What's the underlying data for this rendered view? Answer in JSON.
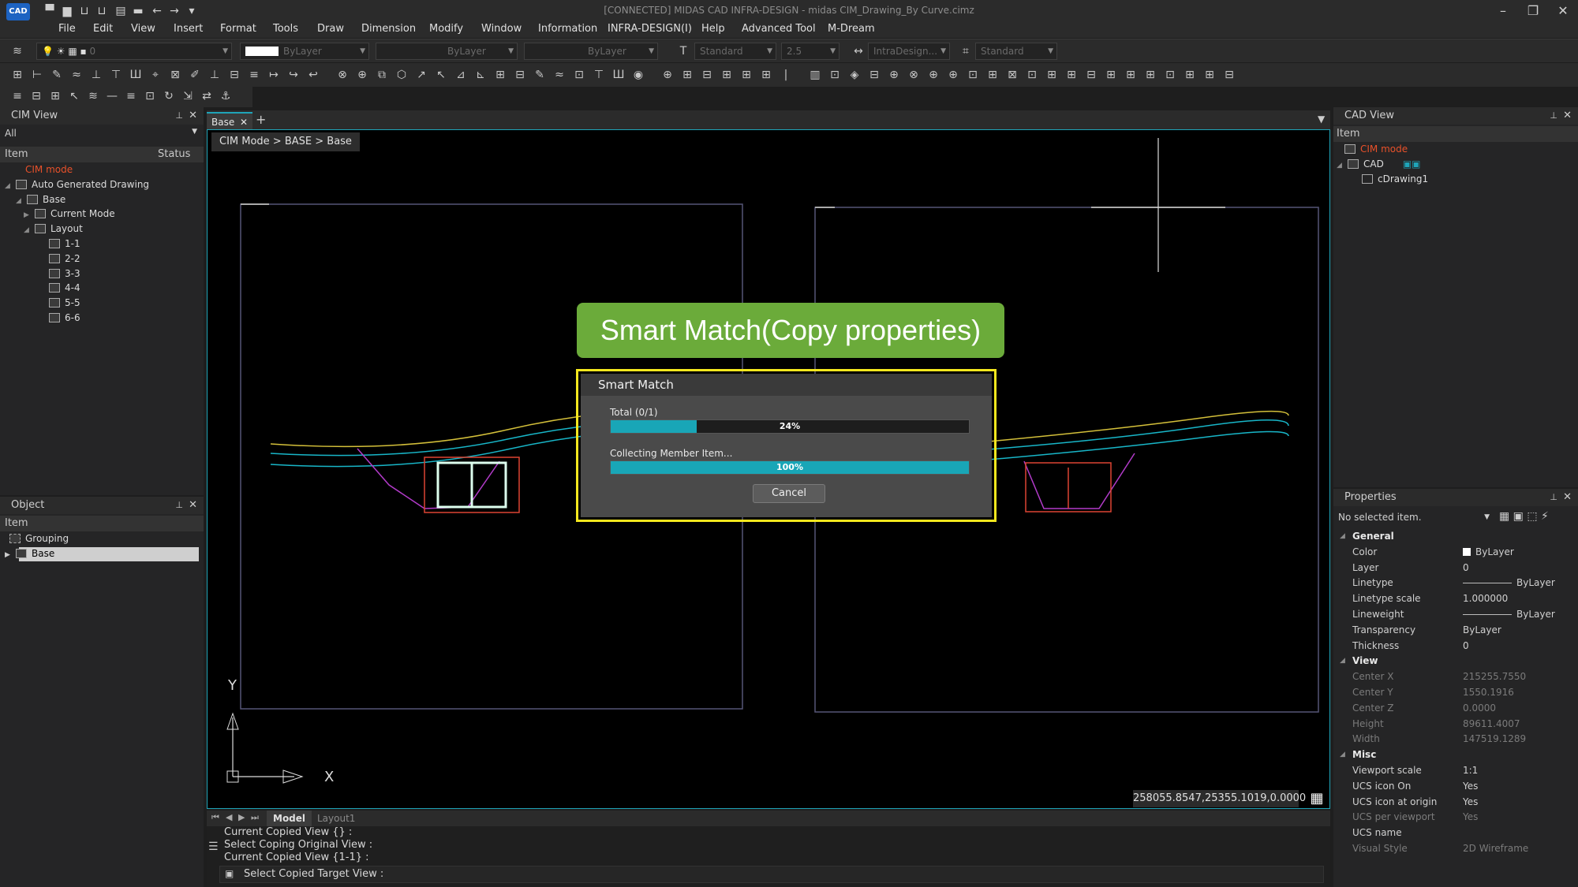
{
  "titlebar": {
    "logo": "CAD",
    "title": "[CONNECTED] MIDAS CAD INFRA-DESIGN - midas CIM_Drawing_By Curve.cimz",
    "quick_icons": [
      "new-icon",
      "open-icon",
      "import-icon",
      "export-icon",
      "print-icon",
      "save-icon",
      "stop-icon",
      "undo-icon",
      "redo-icon",
      "dropdown-icon"
    ]
  },
  "menu": [
    "File",
    "Edit",
    "View",
    "Insert",
    "Format",
    "Tools",
    "Draw",
    "Dimension",
    "Modify",
    "Window",
    "Information",
    "INFRA-DESIGN(I)",
    "Help",
    "Advanced Tool",
    "M-Dream"
  ],
  "toolbar1": {
    "layer": "0",
    "color": "ByLayer",
    "linetype": "ByLayer",
    "lineweight": "ByLayer",
    "text_style": "Standard",
    "text_height": "2.5",
    "dim_style": "IntraDesign...",
    "table_style": "Standard"
  },
  "cim_view": {
    "title": "CIM View",
    "filter": "All",
    "columns": [
      "Item",
      "Status"
    ],
    "tree": [
      {
        "label": "CIM mode",
        "level": 1,
        "accent": true
      },
      {
        "label": "Auto Generated Drawing",
        "level": 0
      },
      {
        "label": "Base",
        "level": 1
      },
      {
        "label": "Current Mode",
        "level": 2
      },
      {
        "label": "Layout",
        "level": 2
      },
      {
        "label": "1-1",
        "level": 3
      },
      {
        "label": "2-2",
        "level": 3
      },
      {
        "label": "3-3",
        "level": 3
      },
      {
        "label": "4-4",
        "level": 3
      },
      {
        "label": "5-5",
        "level": 3
      },
      {
        "label": "6-6",
        "level": 3
      }
    ]
  },
  "object_panel": {
    "title": "Object",
    "column": "Item",
    "items": [
      "Grouping",
      "Base"
    ]
  },
  "tabs": {
    "active": "Base"
  },
  "breadcrumb": "CIM Mode > BASE > Base",
  "banner": "Smart Match(Copy properties)",
  "dialog": {
    "title": "Smart Match",
    "total_label": "Total (0/1)",
    "total_progress": 0.24,
    "total_text": "24%",
    "member_label": "Collecting Member Item...",
    "member_progress": 1.0,
    "member_text": "100%",
    "cancel": "Cancel"
  },
  "coordinates": "258055.8547,25355.1019,0.0000",
  "axes": {
    "y": "Y",
    "x": "X"
  },
  "layout_tabs": [
    "Model",
    "Layout1"
  ],
  "command_lines": [
    "Current Copied View {} :",
    "Select Coping Original View :",
    "Current Copied View {1-1} :"
  ],
  "command_prompt": "Select Copied Target View :",
  "cad_view": {
    "title": "CAD View",
    "column": "Item",
    "tree": [
      {
        "label": "CIM mode",
        "accent": true
      },
      {
        "label": "CAD"
      },
      {
        "label": "cDrawing1"
      }
    ]
  },
  "properties": {
    "title": "Properties",
    "selection": "No selected item.",
    "sections": [
      {
        "name": "General",
        "rows": [
          {
            "k": "Color",
            "v": "ByLayer",
            "swatch": true
          },
          {
            "k": "Layer",
            "v": "0"
          },
          {
            "k": "Linetype",
            "v": "ByLayer",
            "line": true
          },
          {
            "k": "Linetype scale",
            "v": "1.000000"
          },
          {
            "k": "Lineweight",
            "v": "ByLayer",
            "line": true
          },
          {
            "k": "Transparency",
            "v": "ByLayer"
          },
          {
            "k": "Thickness",
            "v": "0"
          }
        ]
      },
      {
        "name": "View",
        "rows": [
          {
            "k": "Center X",
            "v": "215255.7550",
            "dim": true
          },
          {
            "k": "Center Y",
            "v": "1550.1916",
            "dim": true
          },
          {
            "k": "Center Z",
            "v": "0.0000",
            "dim": true
          },
          {
            "k": "Height",
            "v": "89611.4007",
            "dim": true
          },
          {
            "k": "Width",
            "v": "147519.1289",
            "dim": true
          }
        ]
      },
      {
        "name": "Misc",
        "rows": [
          {
            "k": "Viewport scale",
            "v": "1:1"
          },
          {
            "k": "UCS icon On",
            "v": "Yes"
          },
          {
            "k": "UCS icon at origin",
            "v": "Yes"
          },
          {
            "k": "UCS per viewport",
            "v": "Yes",
            "dim": true
          },
          {
            "k": "UCS name",
            "v": ""
          },
          {
            "k": "Visual Style",
            "v": "2D Wireframe",
            "dim": true
          }
        ]
      }
    ]
  },
  "colors": {
    "accent": "#1fa4b8",
    "banner": "#6bab3a",
    "highlight": "#f4e71e",
    "cim_mode": "#e8512a"
  }
}
